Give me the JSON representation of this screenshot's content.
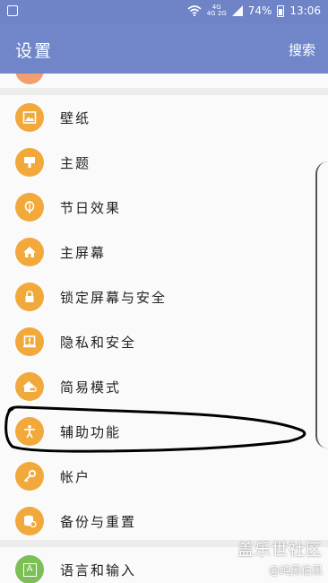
{
  "status_bar": {
    "network_top": "4G",
    "network_left": "4G",
    "network_right": "2G",
    "battery": "74%",
    "time": "13:06"
  },
  "app_bar": {
    "title": "设置",
    "search": "搜索"
  },
  "settings_items": [
    {
      "label": "壁纸",
      "icon": "wallpaper-icon"
    },
    {
      "label": "主题",
      "icon": "theme-icon"
    },
    {
      "label": "节日效果",
      "icon": "festival-effect-icon"
    },
    {
      "label": "主屏幕",
      "icon": "home-icon"
    },
    {
      "label": "锁定屏幕与安全",
      "icon": "lock-icon"
    },
    {
      "label": "隐私和安全",
      "icon": "privacy-icon"
    },
    {
      "label": "简易模式",
      "icon": "easy-mode-icon"
    },
    {
      "label": "辅助功能",
      "icon": "accessibility-icon"
    },
    {
      "label": "帐户",
      "icon": "key-icon"
    },
    {
      "label": "备份与重置",
      "icon": "backup-icon"
    }
  ],
  "next_section": {
    "label": "语言和输入",
    "icon": "language-icon",
    "icon_letter": "A"
  },
  "watermark": {
    "site": "盖乐世社区",
    "user": "@纯黑伯黑"
  },
  "colors": {
    "header": "#7186c8",
    "icon_orange": "#f2a93b",
    "icon_green": "#7bbf55"
  }
}
